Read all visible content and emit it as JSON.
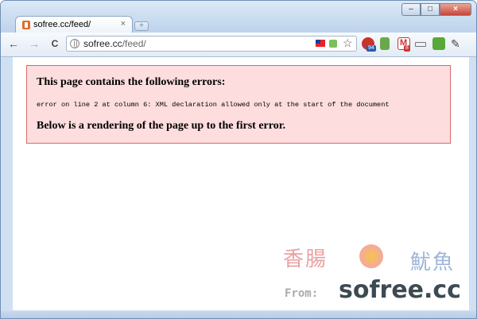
{
  "tab": {
    "title": "sofree.cc/feed/",
    "close_glyph": "×"
  },
  "window_controls": {
    "minimize": "–",
    "maximize": "□",
    "close": "×"
  },
  "toolbar": {
    "back": "←",
    "forward": "→",
    "reload": "C"
  },
  "omnibox": {
    "host": "sofree.cc",
    "path": "/feed/"
  },
  "extensions": [
    {
      "name": "flag-icon"
    },
    {
      "name": "rss-icon"
    },
    {
      "name": "bookmark-star-icon"
    },
    {
      "name": "extension-red-icon",
      "badge": "94"
    },
    {
      "name": "extension-green-download-icon"
    },
    {
      "name": "gmail-icon",
      "badge": "8"
    },
    {
      "name": "page-action-icon"
    },
    {
      "name": "extension-green-square-icon"
    },
    {
      "name": "wrench-icon"
    }
  ],
  "error": {
    "heading1": "This page contains the following errors:",
    "message": "error on line 2 at column 6: XML declaration allowed only at the start of the document",
    "heading2": "Below is a rendering of the page up to the first error."
  },
  "watermark": {
    "left_cn": "香腸",
    "right_cn": "魷魚",
    "from": "From:",
    "site": "sofree.cc"
  },
  "colors": {
    "error_bg": "#fddddd",
    "error_border": "#d46a6a"
  }
}
